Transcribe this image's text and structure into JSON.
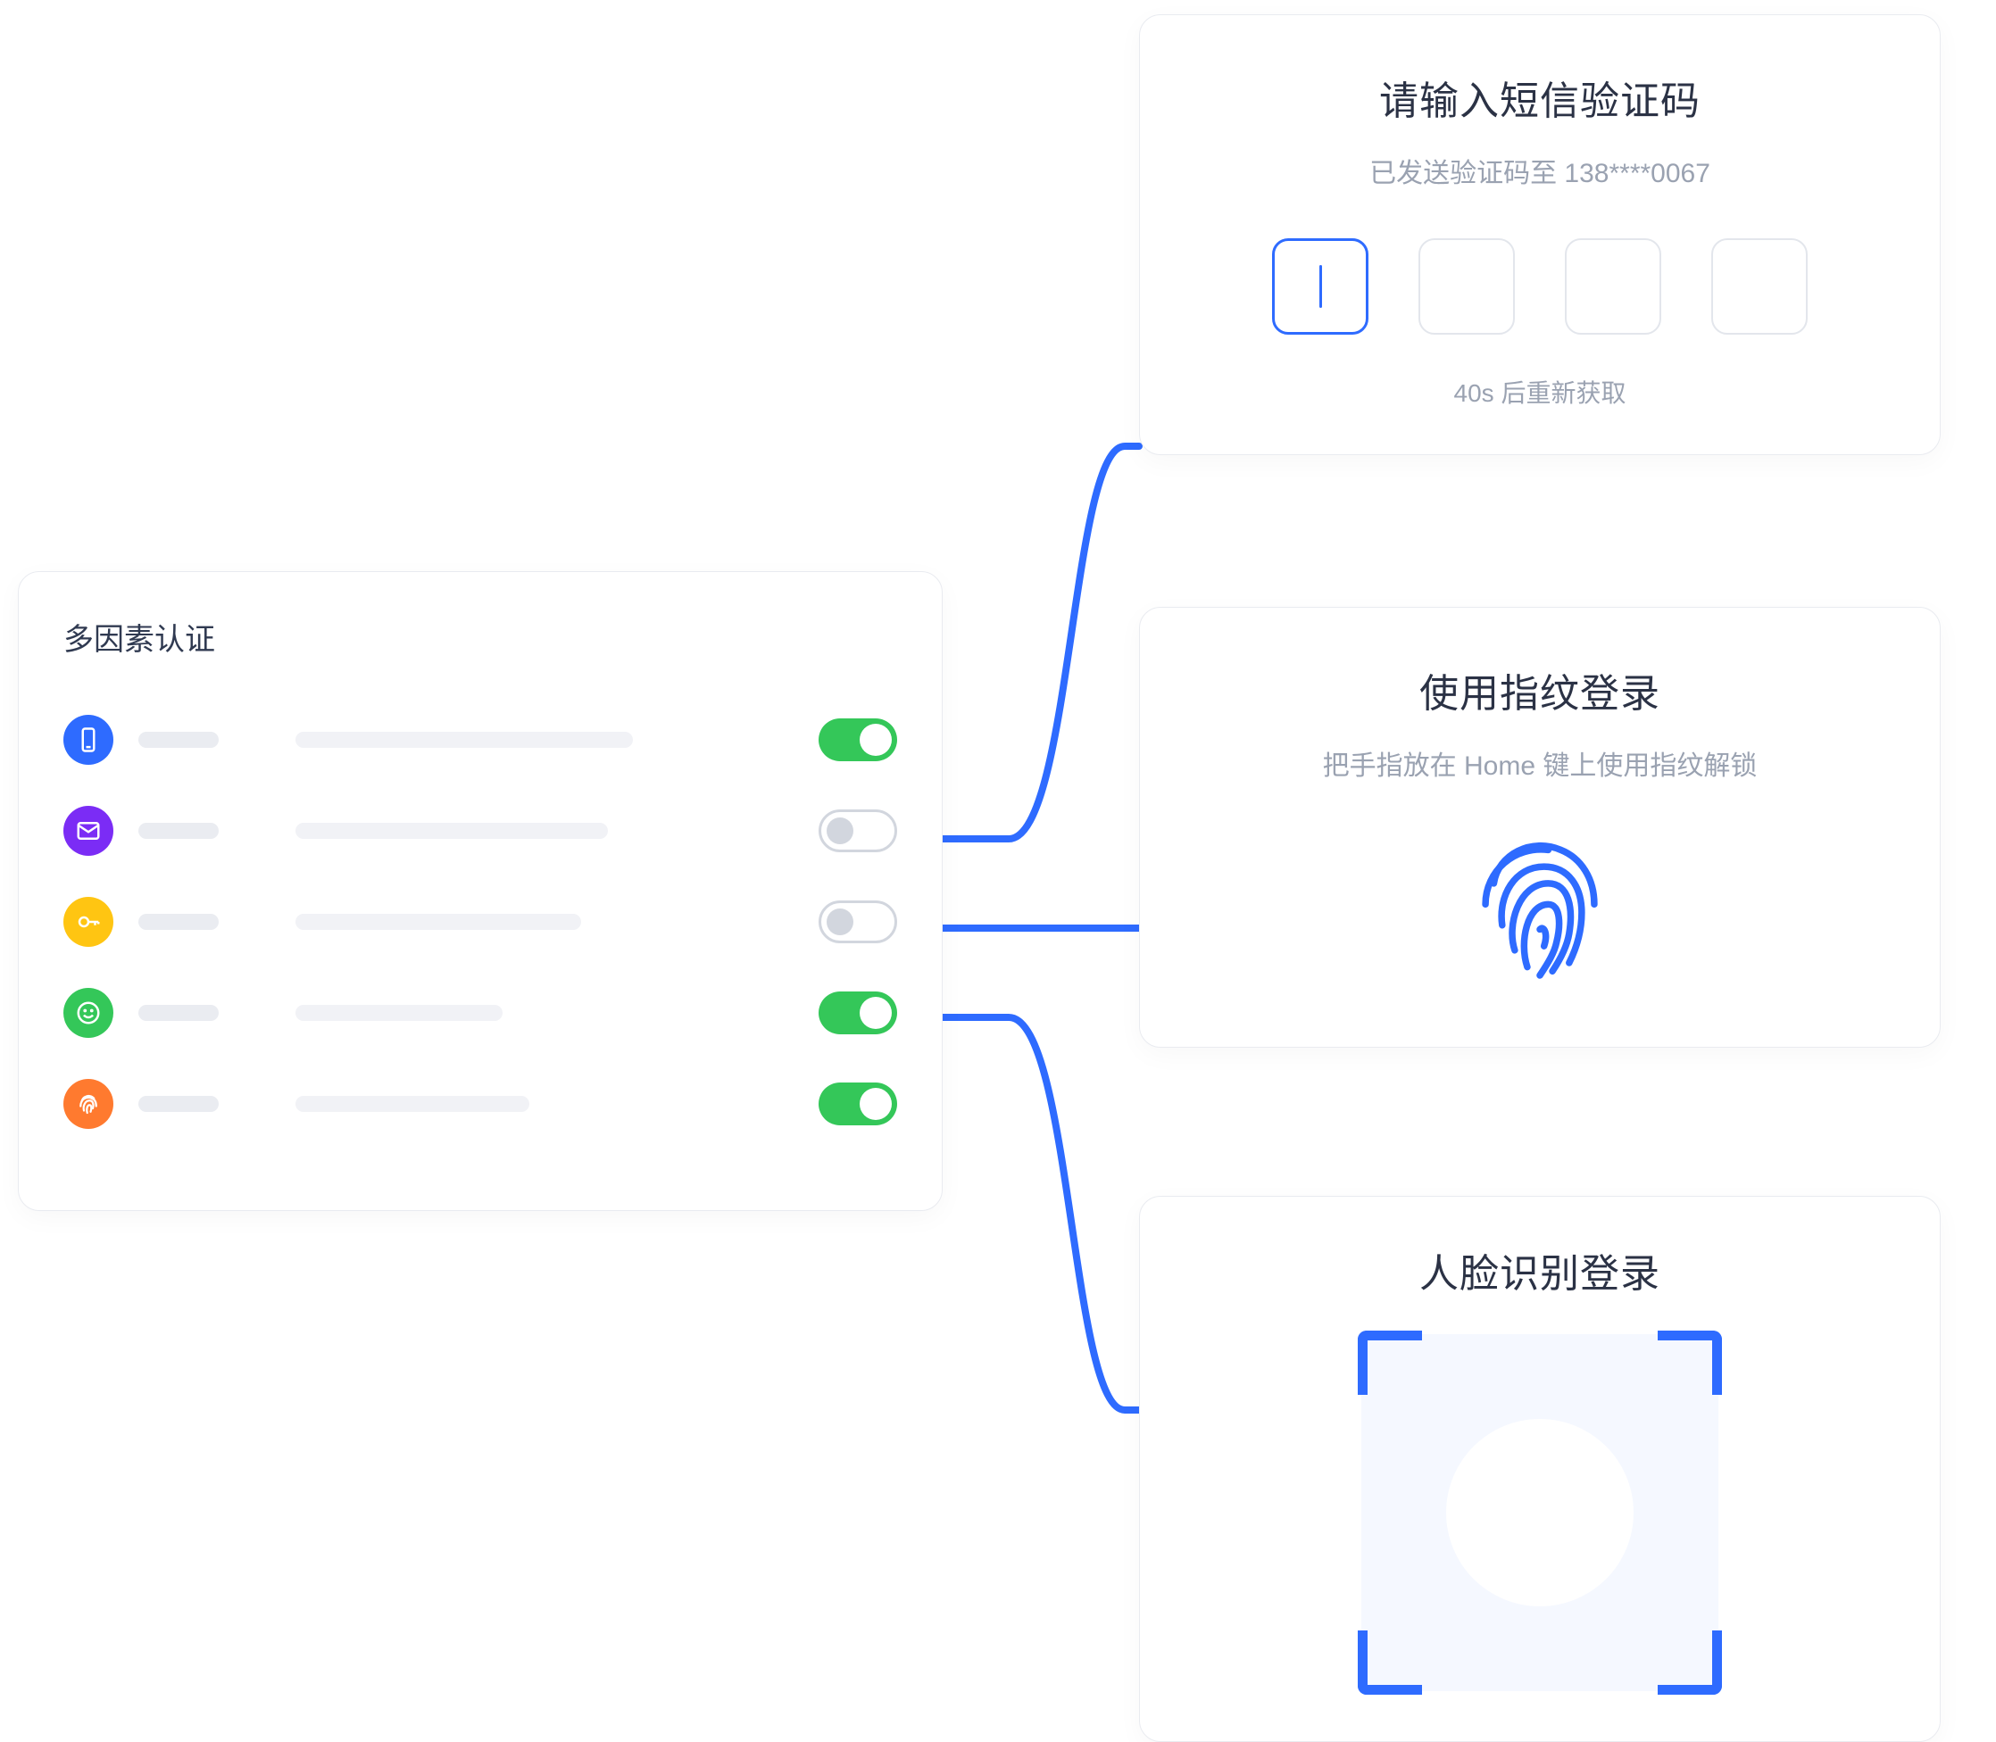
{
  "colors": {
    "accent": "#2E6BFF",
    "toggle_on": "#34C759",
    "toggle_off_border": "#D2D6DE",
    "text_primary": "#2B3245",
    "text_muted": "#9AA2B1"
  },
  "mfa": {
    "title": "多因素认证",
    "items": [
      {
        "icon": "phone-icon",
        "color": "#2E6BFF",
        "bar_long_w": 378,
        "toggle_on": true
      },
      {
        "icon": "mail-icon",
        "color": "#7B2CF5",
        "bar_long_w": 350,
        "toggle_on": false
      },
      {
        "icon": "key-icon",
        "color": "#FFC512",
        "bar_long_w": 320,
        "toggle_on": false
      },
      {
        "icon": "smile-icon",
        "color": "#34C759",
        "bar_long_w": 232,
        "toggle_on": true
      },
      {
        "icon": "fingerprint-small-icon",
        "color": "#FF7A2F",
        "bar_long_w": 262,
        "toggle_on": true
      }
    ]
  },
  "sms": {
    "title": "请输入短信验证码",
    "subtitle": "已发送验证码至 138****0067",
    "code_length": 4,
    "active_index": 0,
    "resend": "40s 后重新获取"
  },
  "fingerprint": {
    "title": "使用指纹登录",
    "subtitle": "把手指放在 Home 键上使用指纹解锁"
  },
  "face": {
    "title": "人脸识别登录"
  }
}
